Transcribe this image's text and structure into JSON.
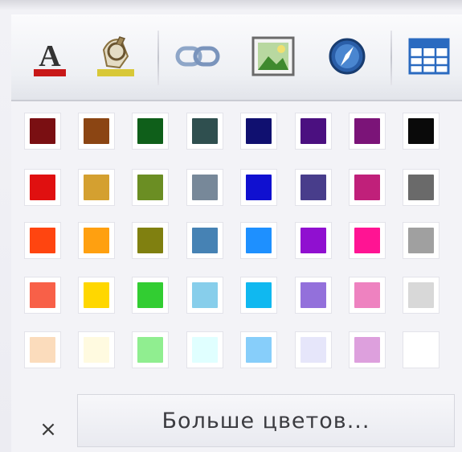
{
  "toolbar": {
    "buttons": [
      {
        "icon": "text-color-icon"
      },
      {
        "icon": "highlight-color-icon"
      },
      {
        "icon": "link-icon"
      },
      {
        "icon": "image-icon"
      },
      {
        "icon": "compass-icon"
      },
      {
        "icon": "table-icon"
      }
    ]
  },
  "palette": {
    "rows": [
      [
        "#7a0f12",
        "#8b4513",
        "#0f5f1a",
        "#2f4f4f",
        "#101070",
        "#4b1080",
        "#7b1478",
        "#0a0a0a"
      ],
      [
        "#e01010",
        "#d4a030",
        "#6b8e23",
        "#778899",
        "#1010d0",
        "#483d8b",
        "#c0207a",
        "#6a6a6a"
      ],
      [
        "#ff4510",
        "#ffa010",
        "#808010",
        "#4682b4",
        "#1e90ff",
        "#9010d0",
        "#ff1493",
        "#a0a0a0"
      ],
      [
        "#f86048",
        "#ffd700",
        "#32cd32",
        "#87ceeb",
        "#10b8f0",
        "#9370db",
        "#ee82c0",
        "#d8d8d8"
      ],
      [
        "#fbdcbc",
        "#fffae0",
        "#90ee90",
        "#e0ffff",
        "#87cefa",
        "#e6e6fa",
        "#dda0dd",
        "#ffffff"
      ]
    ]
  },
  "footer": {
    "close_label": "×",
    "more_colors_label": "Больше цветов..."
  }
}
